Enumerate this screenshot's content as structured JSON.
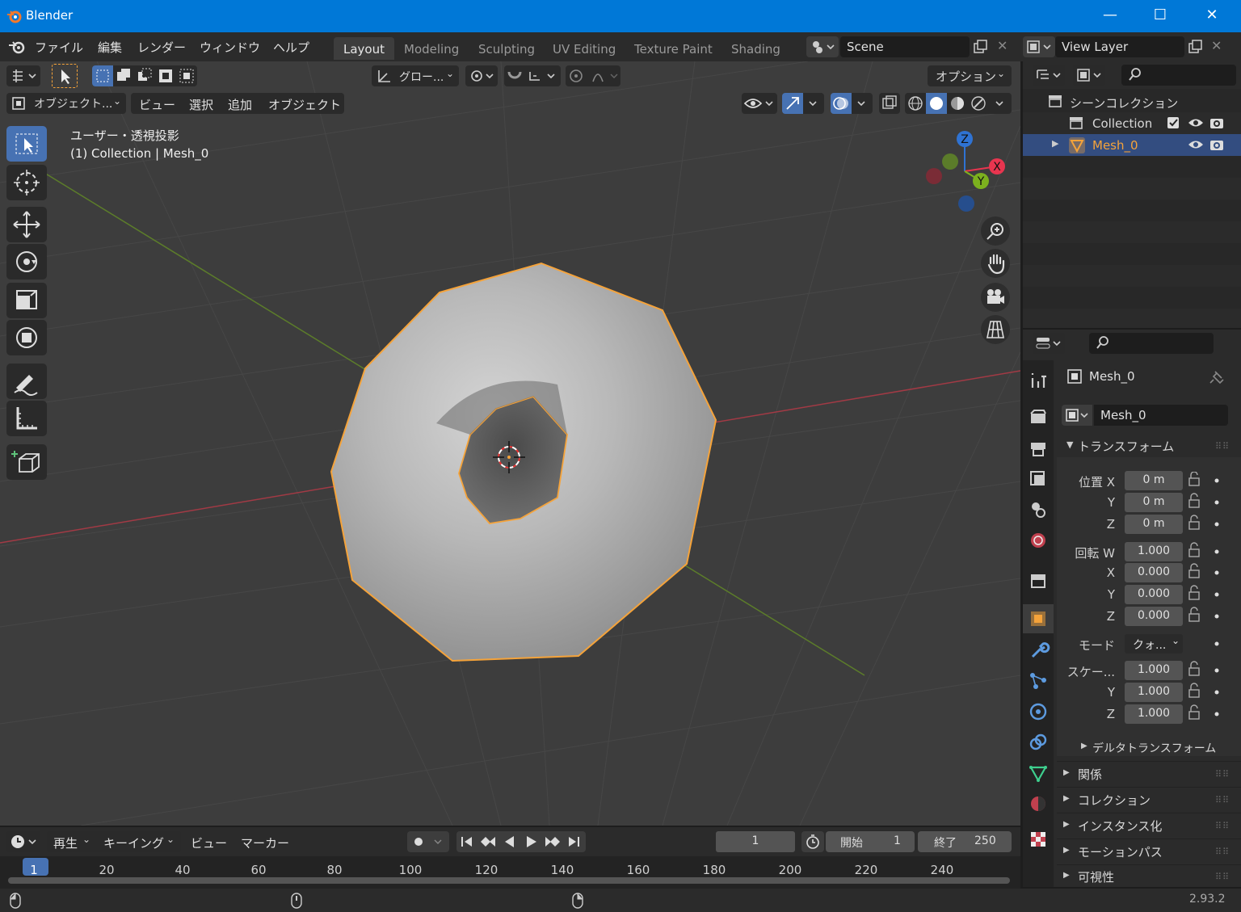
{
  "window": {
    "title": "Blender",
    "minimize": "—",
    "maximize": "☐",
    "close": "✕"
  },
  "menu": [
    "ファイル",
    "編集",
    "レンダー",
    "ウィンドウ",
    "ヘルプ"
  ],
  "workspaces": [
    "Layout",
    "Modeling",
    "Sculpting",
    "UV Editing",
    "Texture Paint",
    "Shading"
  ],
  "scene": {
    "name": "Scene"
  },
  "view_layer": {
    "name": "View Layer"
  },
  "tool_header": {
    "transform_orientation": "グロー...",
    "options": "オプション"
  },
  "viewport_header": {
    "mode": "オブジェクト...",
    "view": "ビュー",
    "select": "選択",
    "add": "追加",
    "object": "オブジェクト"
  },
  "overlay_text": {
    "view_name": "ユーザー・透視投影",
    "collection_info": "(1) Collection | Mesh_0"
  },
  "gizmo": {
    "z": "Z",
    "x": "X",
    "y": "Y"
  },
  "outliner": {
    "root": "シーンコレクション",
    "collection": "Collection",
    "object": "Mesh_0"
  },
  "properties": {
    "object_name": "Mesh_0",
    "datablock": "Mesh_0",
    "transform_panel": "トランスフォーム",
    "location_label": "位置 X",
    "loc_x": "0 m",
    "loc_y": "0 m",
    "loc_z": "0 m",
    "rotation_label": "回転 W",
    "rot_w": "1.000",
    "rot_x": "0.000",
    "rot_y": "0.000",
    "rot_z": "0.000",
    "mode_label": "モード",
    "mode_value": "クォ...",
    "scale_label": "スケー...",
    "scale_x": "1.000",
    "scale_y": "1.000",
    "scale_z": "1.000",
    "y_label": "Y",
    "z_label": "Z",
    "x_label": "X",
    "delta": "デルタトランスフォーム",
    "relations": "関係",
    "collections": "コレクション",
    "instancing": "インスタンス化",
    "motion_paths": "モーションパス",
    "visibility": "可視性"
  },
  "timeline": {
    "playback": "再生",
    "keying": "キーイング",
    "view": "ビュー",
    "marker": "マーカー",
    "current_frame": "1",
    "start_label": "開始",
    "start": "1",
    "end_label": "終了",
    "end": "250",
    "ruler": [
      "1",
      "20",
      "40",
      "60",
      "80",
      "100",
      "120",
      "140",
      "160",
      "180",
      "200",
      "220",
      "240"
    ]
  },
  "status": {
    "version": "2.93.2"
  },
  "colors": {
    "accent_blue": "#4772b3",
    "selection_orange": "#f5a33a",
    "axis_red": "#e8354f",
    "axis_green": "#7cb11e",
    "axis_blue": "#2f73d3"
  }
}
